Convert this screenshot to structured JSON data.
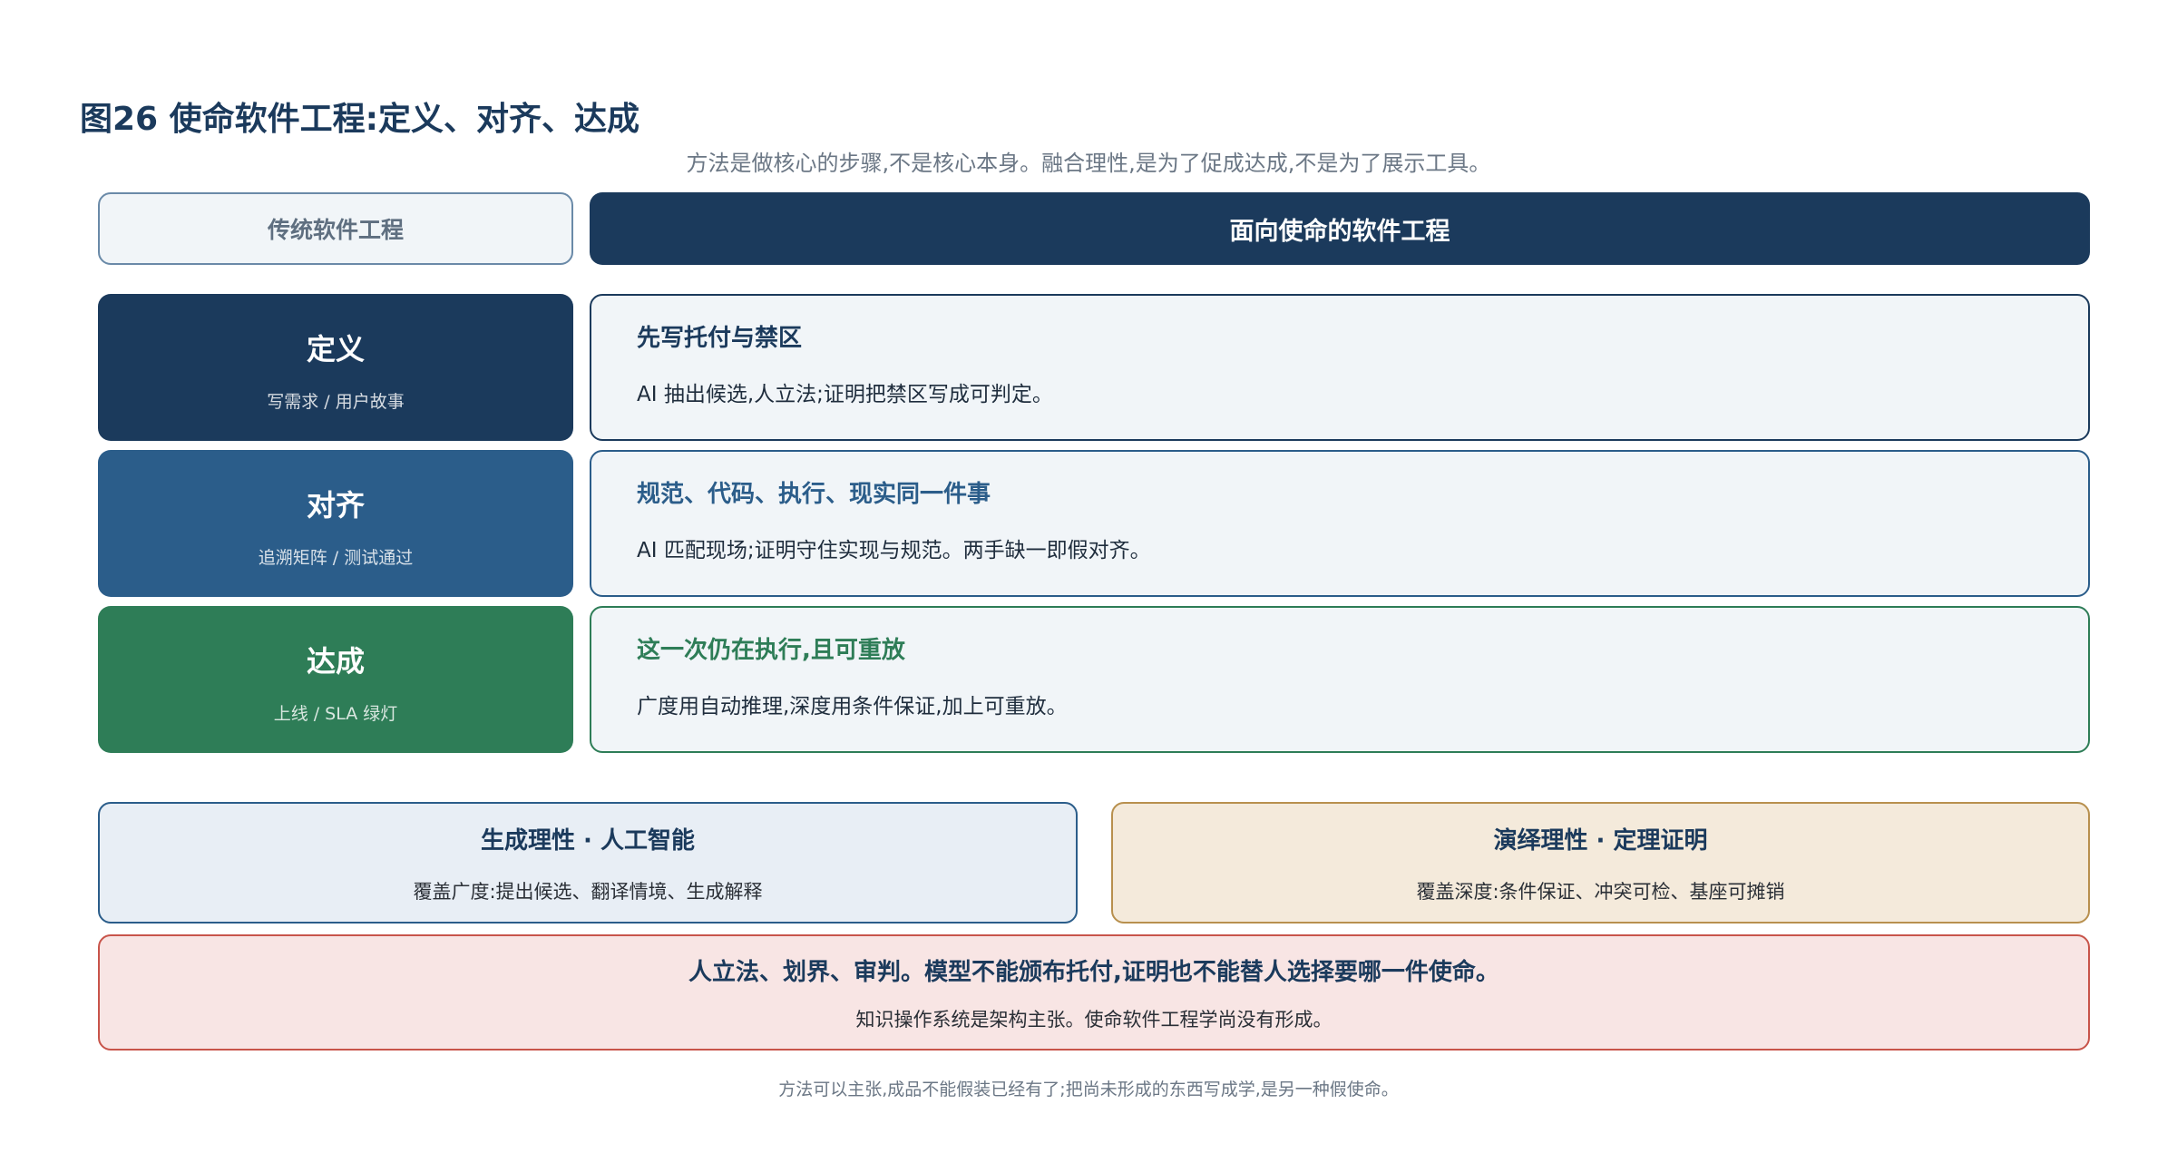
{
  "title": "图26  使命软件工程:定义、对齐、达成",
  "subtitle": "方法是做核心的步骤,不是核心本身。融合理性,是为了促成达成,不是为了展示工具。",
  "header": {
    "left": "传统软件工程",
    "right": "面向使命的软件工程"
  },
  "rows": [
    {
      "stage": "定义",
      "stage_sub": "写需求 / 用户故事",
      "detail_title": "先写托付与禁区",
      "detail_body": "AI 抽出候选,人立法;证明把禁区写成可判定。",
      "color": "#1b3a5c"
    },
    {
      "stage": "对齐",
      "stage_sub": "追溯矩阵 / 测试通过",
      "detail_title": "规范、代码、执行、现实同一件事",
      "detail_body": "AI 匹配现场;证明守住实现与规范。两手缺一即假对齐。",
      "color": "#2b5d8a"
    },
    {
      "stage": "达成",
      "stage_sub": "上线 / SLA 绿灯",
      "detail_title": "这一次仍在执行,且可重放",
      "detail_body": "广度用自动推理,深度用条件保证,加上可重放。",
      "color": "#2e7d57"
    }
  ],
  "pillars": {
    "left": {
      "title": "生成理性 · 人工智能",
      "body": "覆盖广度:提出候选、翻译情境、生成解释",
      "bg": "#e8eef5",
      "border": "#2b5d8a"
    },
    "right": {
      "title": "演绎理性 · 定理证明",
      "body": "覆盖深度:条件保证、冲突可检、基座可摊销",
      "bg": "#f4eadb",
      "border": "#b8904e"
    }
  },
  "note": {
    "title": "人立法、划界、审判。模型不能颁布托付,证明也不能替人选择要哪一件使命。",
    "body": "知识操作系统是架构主张。使命软件工程学尚没有形成。"
  },
  "footer": "方法可以主张,成品不能假装已经有了;把尚未形成的东西写成学,是另一种假使命。"
}
